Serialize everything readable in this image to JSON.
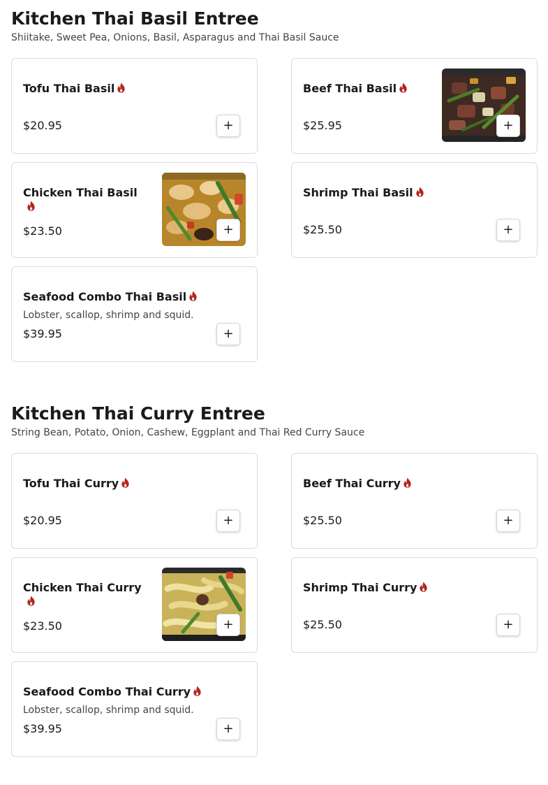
{
  "colors": {
    "flame": "#b3261e",
    "border": "#dcdcdc"
  },
  "icons": {
    "spicy": "flame-icon",
    "add": "plus-icon"
  },
  "sections": [
    {
      "title": "Kitchen Thai Basil Entree",
      "subtitle": "Shiitake, Sweet Pea, Onions, Basil, Asparagus and Thai Basil Sauce",
      "items": [
        {
          "name": "Tofu Thai Basil",
          "price": "$20.95",
          "add_label": "+"
        },
        {
          "name": "Beef Thai Basil",
          "price": "$25.95",
          "add_label": "+",
          "image": "beef-thai-basil-photo"
        },
        {
          "name": "Chicken Thai Basil",
          "price": "$23.50",
          "add_label": "+",
          "image": "chicken-thai-basil-photo"
        },
        {
          "name": "Shrimp Thai Basil",
          "price": "$25.50",
          "add_label": "+"
        },
        {
          "name": "Seafood Combo Thai Basil",
          "description": "Lobster, scallop, shrimp and squid.",
          "price": "$39.95",
          "add_label": "+"
        }
      ]
    },
    {
      "title": "Kitchen Thai Curry Entree",
      "subtitle": "String Bean, Potato, Onion, Cashew, Eggplant and Thai Red Curry Sauce",
      "items": [
        {
          "name": "Tofu Thai Curry",
          "price": "$20.95",
          "add_label": "+"
        },
        {
          "name": "Beef Thai Curry",
          "price": "$25.50",
          "add_label": "+"
        },
        {
          "name": "Chicken Thai Curry",
          "price": "$23.50",
          "add_label": "+",
          "image": "chicken-thai-curry-photo"
        },
        {
          "name": "Shrimp Thai Curry",
          "price": "$25.50",
          "add_label": "+"
        },
        {
          "name": "Seafood Combo Thai Curry",
          "description": "Lobster, scallop, shrimp and squid.",
          "price": "$39.95",
          "add_label": "+"
        }
      ]
    }
  ]
}
